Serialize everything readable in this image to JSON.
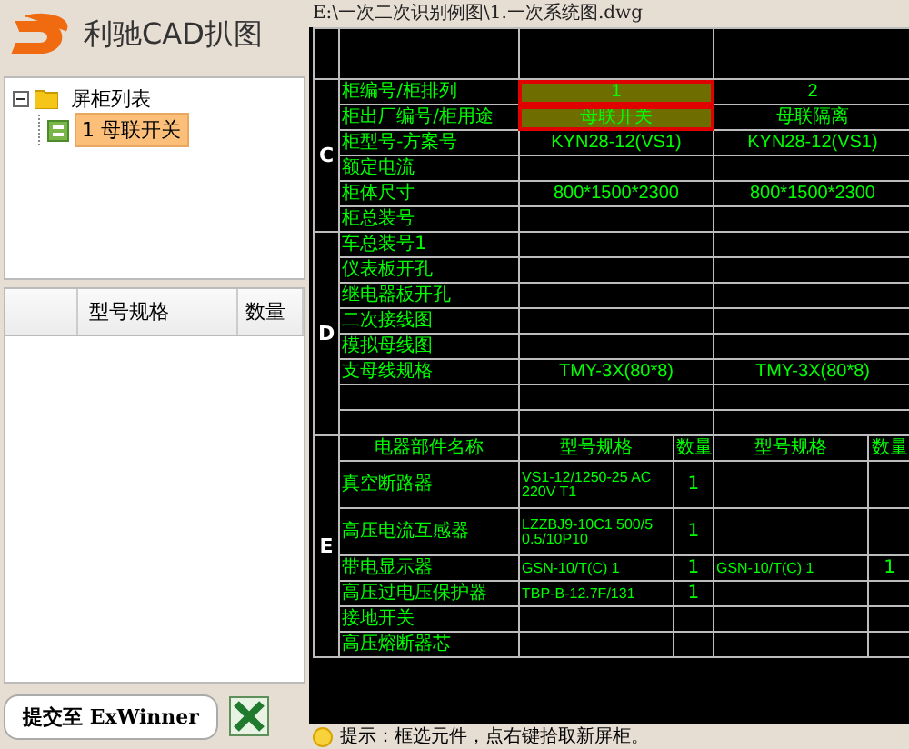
{
  "app": {
    "title": "利驰CAD扒图"
  },
  "tree": {
    "label": "屏柜列表",
    "expanded": true,
    "children": [
      {
        "label": "1 母联开关",
        "selected": true
      }
    ]
  },
  "parts_table": {
    "columns": [
      "型号规格",
      "数量"
    ]
  },
  "submit_button": "提交至 ExWinner",
  "file_path": "E:\\一次二次识别例图\\1.一次系统图.dwg",
  "drawing": {
    "sections": [
      {
        "letter": "C",
        "rows": [
          {
            "label": "柜编号/柜排列",
            "values": [
              {
                "text": "1",
                "selected": true
              },
              {
                "text": "2",
                "selected": false
              }
            ]
          },
          {
            "label": "柜出厂编号/柜用途",
            "values": [
              {
                "text": "母联开关",
                "selected": true
              },
              {
                "text": "母联隔离",
                "selected": false
              }
            ]
          },
          {
            "label": "柜型号-方案号",
            "values": [
              {
                "text": "KYN28-12(VS1)",
                "selected": false
              },
              {
                "text": "KYN28-12(VS1)",
                "selected": false
              }
            ]
          },
          {
            "label": "额定电流"
          },
          {
            "label": "柜体尺寸",
            "values": [
              {
                "text": "800*1500*2300",
                "selected": false
              },
              {
                "text": "800*1500*2300",
                "selected": false
              }
            ]
          },
          {
            "label": "柜总装号"
          }
        ]
      },
      {
        "letter": "D",
        "rows": [
          {
            "label": "车总装号1"
          },
          {
            "label": "仪表板开孔"
          },
          {
            "label": "继电器板开孔"
          },
          {
            "label": "二次接线图"
          },
          {
            "label": "模拟母线图"
          },
          {
            "label": "支母线规格",
            "values": [
              {
                "text": "TMY-3X(80*8)",
                "selected": false
              },
              {
                "text": "TMY-3X(80*8)",
                "selected": false
              }
            ]
          },
          {},
          {}
        ]
      }
    ],
    "components": {
      "letter": "E",
      "columns": [
        "电器部件名称",
        "型号规格",
        "数量",
        "型号规格",
        "数量"
      ],
      "rows": [
        {
          "name": "真空断路器",
          "spec": "VS1-12/1250-25 AC 220V T1",
          "qty": "1"
        },
        {
          "name": "高压电流互感器",
          "spec": "LZZBJ9-10C1 500/5 0.5/10P10",
          "qty": "1"
        },
        {
          "name": "带电显示器",
          "spec": "GSN-10/T(C) 1",
          "qty": "1",
          "spec2": "GSN-10/T(C) 1",
          "qty2": "1"
        },
        {
          "name": "高压过电压保护器",
          "spec": "TBP-B-12.7F/131",
          "qty": "1"
        },
        {
          "name": "接地开关"
        },
        {
          "name": "高压熔断器芯"
        }
      ]
    }
  },
  "status": "提示：框选元件，点右键拾取新屏柜。"
}
